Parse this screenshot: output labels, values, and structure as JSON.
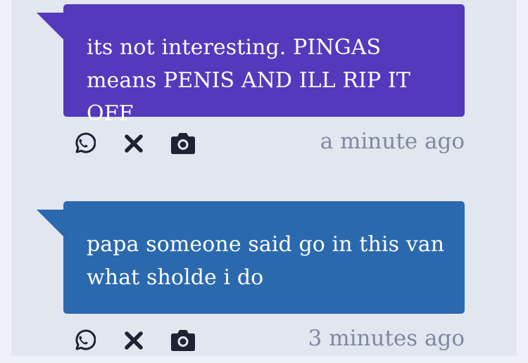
{
  "messages": [
    {
      "text": "its not interesting. PINGAS means PENIS AND ILL RIP IT OFF",
      "timestamp": "a minute ago",
      "color": "#5439bd"
    },
    {
      "text": "papa someone said go in this van what sholde i do",
      "timestamp": "3 minutes ago",
      "color": "#2b69af"
    }
  ],
  "icons": {
    "share": "whatsapp-icon",
    "delete": "close-icon",
    "capture": "camera-icon"
  }
}
